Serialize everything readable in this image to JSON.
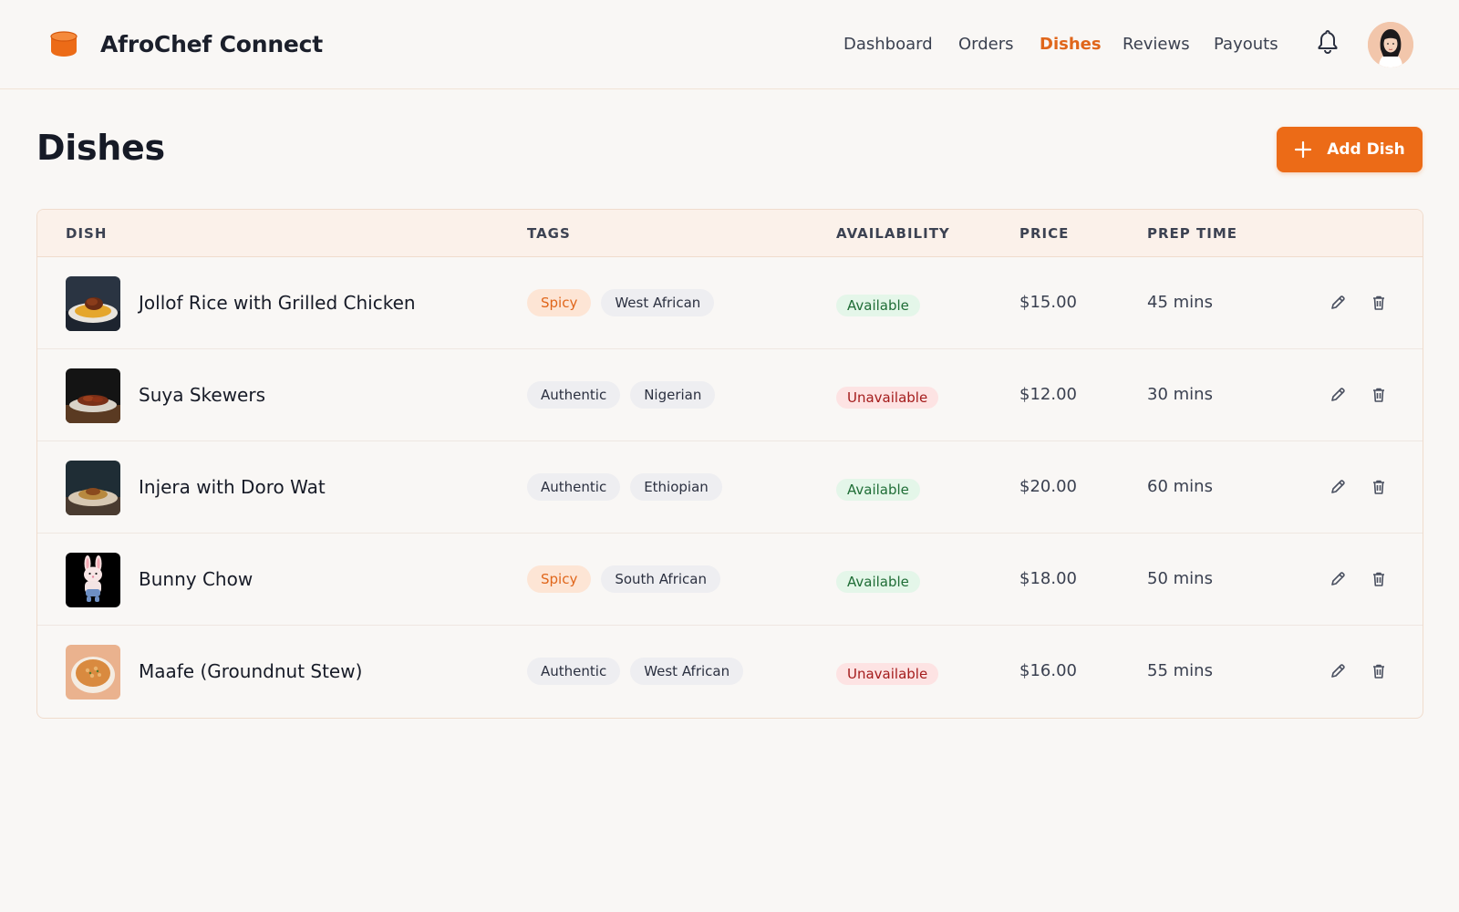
{
  "header": {
    "brand_name": "AfroChef Connect",
    "brand_icon": "cylinder-pot-icon",
    "accent_color": "#ec6b17",
    "nav": [
      {
        "label": "Dashboard",
        "active": false
      },
      {
        "label": "Orders",
        "active": false
      },
      {
        "label": "Dishes",
        "active": true
      },
      {
        "label": "Reviews",
        "active": false
      },
      {
        "label": "Payouts",
        "active": false
      }
    ],
    "notification_icon": "bell-icon",
    "avatar_icon": "user-avatar"
  },
  "page": {
    "title": "Dishes",
    "add_button_label": "Add Dish"
  },
  "table": {
    "columns": [
      "DISH",
      "TAGS",
      "AVAILABILITY",
      "PRICE",
      "PREP TIME"
    ],
    "rows": [
      {
        "name": "Jollof Rice with Grilled Chicken",
        "thumb": "jollof-rice-photo",
        "tags": [
          {
            "label": "Spicy",
            "style": "spicy"
          },
          {
            "label": "West African",
            "style": "plain"
          }
        ],
        "availability": "Available",
        "available": true,
        "price": "$15.00",
        "prep_time": "45 mins"
      },
      {
        "name": "Suya Skewers",
        "thumb": "suya-skewers-photo",
        "tags": [
          {
            "label": "Authentic",
            "style": "plain"
          },
          {
            "label": "Nigerian",
            "style": "plain"
          }
        ],
        "availability": "Unavailable",
        "available": false,
        "price": "$12.00",
        "prep_time": "30 mins"
      },
      {
        "name": "Injera with Doro Wat",
        "thumb": "injera-photo",
        "tags": [
          {
            "label": "Authentic",
            "style": "plain"
          },
          {
            "label": "Ethiopian",
            "style": "plain"
          }
        ],
        "availability": "Available",
        "available": true,
        "price": "$20.00",
        "prep_time": "60 mins"
      },
      {
        "name": "Bunny Chow",
        "thumb": "bunny-illustration",
        "tags": [
          {
            "label": "Spicy",
            "style": "spicy"
          },
          {
            "label": "South African",
            "style": "plain"
          }
        ],
        "availability": "Available",
        "available": true,
        "price": "$18.00",
        "prep_time": "50 mins"
      },
      {
        "name": "Maafe (Groundnut Stew)",
        "thumb": "maafe-stew-photo",
        "tags": [
          {
            "label": "Authentic",
            "style": "plain"
          },
          {
            "label": "West African",
            "style": "plain"
          }
        ],
        "availability": "Unavailable",
        "available": false,
        "price": "$16.00",
        "prep_time": "55 mins"
      }
    ],
    "row_actions": [
      "pencil-icon",
      "trash-icon"
    ]
  }
}
